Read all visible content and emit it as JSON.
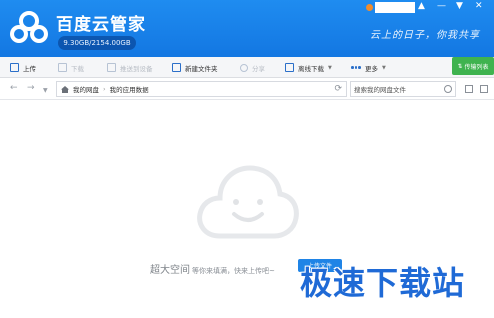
{
  "header": {
    "app_title": "百度云管家",
    "quota": "9.30GB/2154.00GB",
    "slogan": "云上的日子，你我共享",
    "window_controls": [
      "▲",
      "—",
      "▼",
      "✕"
    ]
  },
  "toolbar": {
    "items": [
      {
        "label": "上传",
        "enabled": true,
        "icon": "upload-icon"
      },
      {
        "label": "下载",
        "enabled": false,
        "icon": "download-icon"
      },
      {
        "label": "推送到设备",
        "enabled": false,
        "icon": "push-device-icon"
      },
      {
        "label": "新建文件夹",
        "enabled": true,
        "icon": "new-folder-icon"
      },
      {
        "label": "分享",
        "enabled": false,
        "icon": "share-icon"
      },
      {
        "label": "离线下载",
        "enabled": true,
        "icon": "offline-download-icon"
      },
      {
        "label": "更多",
        "enabled": true,
        "icon": "more-icon"
      }
    ],
    "transfer_list": "传输列表"
  },
  "addressbar": {
    "path": [
      "我的网盘",
      "我的应用数据"
    ],
    "search_placeholder": "搜索我的网盘文件"
  },
  "empty_state": {
    "big_text": "超大空间",
    "small_text": "等你来填满，快来上传吧~",
    "upload_label": "上传文件"
  },
  "watermark": "极速下载站",
  "colors": {
    "header_blue": "#1f8cf0",
    "transfer_green": "#3fb34f",
    "watermark_blue": "#1f6ad6"
  }
}
